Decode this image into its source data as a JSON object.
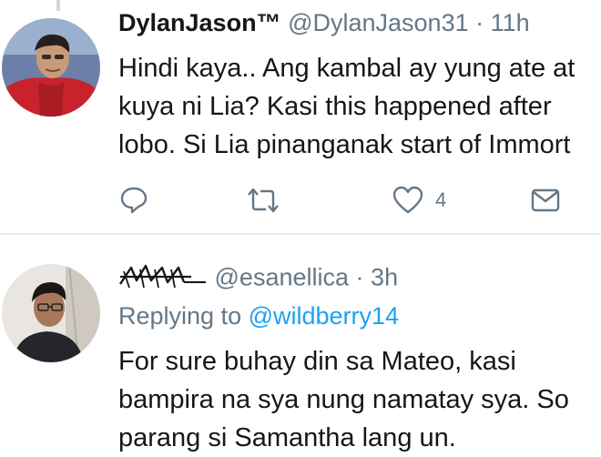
{
  "tweets": [
    {
      "display_name": "DylanJason™",
      "handle": "@DylanJason31",
      "separator": "·",
      "time": "11h",
      "text_lines": [
        "Hindi kaya.. Ang kambal ay yung ate at",
        "kuya ni Lia? Kasi this happened after",
        "lobo. Si Lia pinanganak start of Immort"
      ],
      "actions": {
        "reply_icon": "reply-icon",
        "retweet_icon": "retweet-icon",
        "like_icon": "heart-icon",
        "like_count": "4",
        "dm_icon": "envelope-icon"
      }
    },
    {
      "display_name_style": "signature-glyph",
      "handle": "@esanellica",
      "separator": "·",
      "time": "3h",
      "replying_prefix": "Replying to",
      "replying_to": "@wildberry14",
      "text_lines": [
        "For sure buhay din sa Mateo, kasi",
        "bampira na sya nung namatay sya. So",
        "parang si Samantha lang un."
      ]
    }
  ],
  "colors": {
    "text": "#14171a",
    "muted": "#657786",
    "link": "#1da1f2",
    "divider": "#e6ecf0"
  }
}
